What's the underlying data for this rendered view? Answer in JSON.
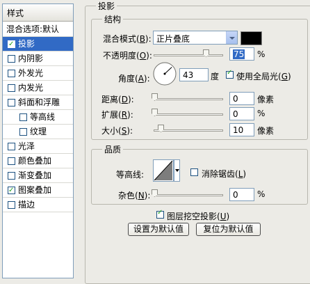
{
  "styles_panel": {
    "title": "样式",
    "blending_options": "混合选项:默认",
    "items": [
      {
        "label": "投影",
        "checked": true,
        "selected": true
      },
      {
        "label": "内阴影",
        "checked": false
      },
      {
        "label": "外发光",
        "checked": false
      },
      {
        "label": "内发光",
        "checked": false
      },
      {
        "label": "斜面和浮雕",
        "checked": false
      },
      {
        "label": "等高线",
        "checked": false
      },
      {
        "label": "纹理",
        "checked": false
      },
      {
        "label": "光泽",
        "checked": false
      },
      {
        "label": "颜色叠加",
        "checked": false
      },
      {
        "label": "渐变叠加",
        "checked": false
      },
      {
        "label": "图案叠加",
        "checked": true
      },
      {
        "label": "描边",
        "checked": false
      }
    ]
  },
  "drop_shadow": {
    "title": "投影",
    "structure": {
      "title": "结构",
      "blend_mode_label": "混合模式(",
      "blend_mode_key": "B",
      "blend_mode_value": "正片叠底",
      "shadow_color": "#000000",
      "opacity_label": "不透明度(",
      "opacity_key": "O",
      "opacity_value": "75",
      "opacity_unit": "%",
      "opacity_fraction": 0.75,
      "angle_label": "角度(",
      "angle_key": "A",
      "angle_value": "43",
      "angle_unit": "度",
      "global_light_label": "使用全局光(",
      "global_light_key": "G",
      "global_light_checked": true,
      "distance_label": "距离(",
      "distance_key": "D",
      "distance_value": "0",
      "distance_unit": "像素",
      "spread_label": "扩展(",
      "spread_key": "R",
      "spread_value": "0",
      "spread_unit": "%",
      "size_label": "大小(",
      "size_key": "S",
      "size_value": "10",
      "size_unit": "像素"
    },
    "quality": {
      "title": "品质",
      "contour_label": "等高线:",
      "anti_alias_label": "消除锯齿(",
      "anti_alias_key": "L",
      "anti_alias_checked": false,
      "noise_label": "杂色(",
      "noise_key": "N",
      "noise_value": "0",
      "noise_unit": "%"
    },
    "layer_knocks_out_label": "图层挖空投影(",
    "layer_knocks_out_key": "U",
    "layer_knocks_out_checked": true,
    "make_default_label": "设置为默认值",
    "reset_default_label": "复位为默认值",
    "close_paren": "):",
    "close_paren_plain": ")"
  }
}
